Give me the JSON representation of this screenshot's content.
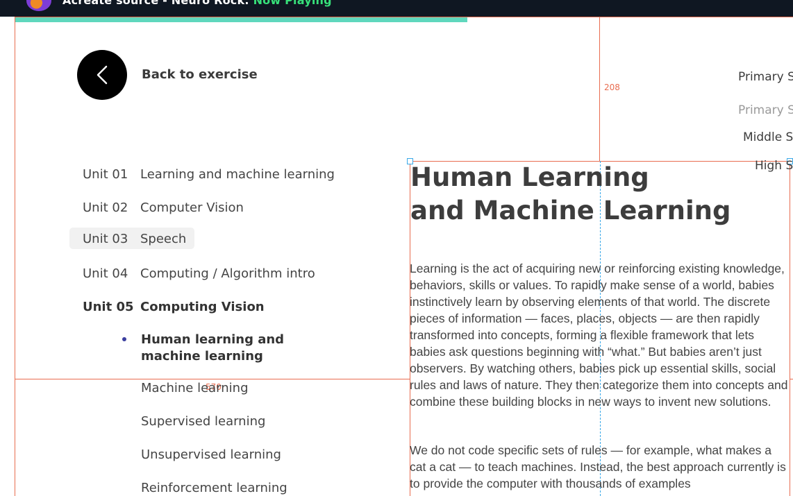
{
  "topbar": {
    "title": "Acreate source - Neuro Rock.",
    "status": "Now Playing"
  },
  "progress": {
    "fraction": 0.57
  },
  "back": {
    "label": "Back to exercise"
  },
  "units": [
    {
      "num": "Unit 01",
      "name": "Learning and machine learning"
    },
    {
      "num": "Unit 02",
      "name": "Computer Vision"
    },
    {
      "num": "Unit 03",
      "name": "Speech"
    },
    {
      "num": "Unit 04",
      "name": "Computing / Algorithm intro"
    },
    {
      "num": "Unit 05",
      "name": "Computing Vision"
    }
  ],
  "subtopics": {
    "current": "Human learning and machine learning",
    "items": [
      "Machine learning",
      "Supervised learning",
      "Unsupervised learning",
      "Reinforcement learning"
    ]
  },
  "levels": [
    "Primary S",
    "Primary S",
    "Middle S",
    "High S"
  ],
  "measurements": {
    "top": "208",
    "left": "570"
  },
  "article": {
    "title_line1": "Human Learning",
    "title_line2": "and Machine Learning",
    "paragraph1": "Learning is the act of acquiring new or reinforcing existing knowledge, behaviors, skills or values. To rapidly make sense of a world, babies instinctively learn by observing elements of that world. The discrete pieces of information — faces, places, objects — are then rapidly transformed into concepts, forming a flexible framework that lets babies ask questions beginning with “what.” But babies aren’t just observers. By watching others, babies pick up essential skills, social rules and laws of nature. They then categorize them into concepts and combine these building blocks in new ways to invent new solutions.",
    "paragraph2": "We do not code specific sets of rules — for example, what makes a cat a cat — to teach machines. Instead, the best approach currently is to provide the computer with thousands of examples"
  },
  "colors": {
    "guide": "#e86c4f",
    "accent": "#5fd7bd",
    "topbar": "#0f1722"
  }
}
